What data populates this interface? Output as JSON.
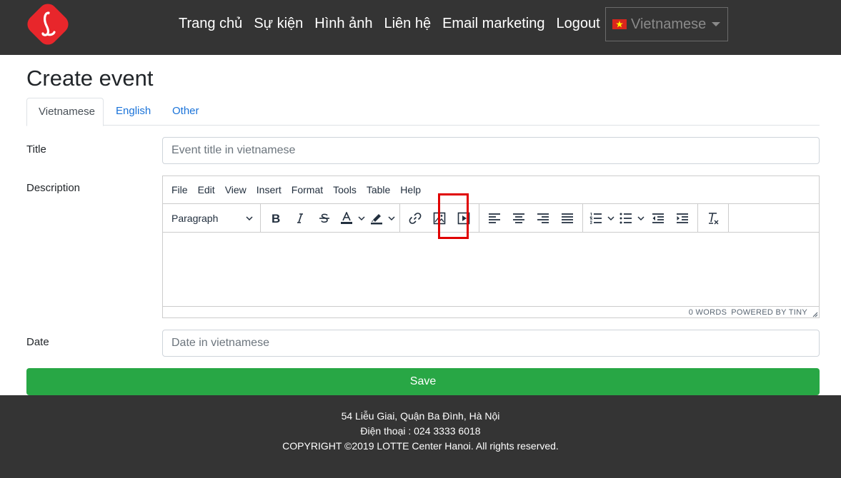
{
  "header": {
    "nav": [
      "Trang chủ",
      "Sự kiện",
      "Hình ảnh",
      "Liên hệ",
      "Email marketing",
      "Logout"
    ],
    "language": "Vietnamese",
    "brand_color": "#e8262b"
  },
  "page": {
    "title": "Create event",
    "tabs": [
      "Vietnamese",
      "English",
      "Other"
    ],
    "active_tab": "Vietnamese"
  },
  "form": {
    "title_label": "Title",
    "title_placeholder": "Event title in vietnamese",
    "description_label": "Description",
    "date_label": "Date",
    "date_placeholder": "Date in vietnamese",
    "save_label": "Save",
    "save_color": "#28a745"
  },
  "editor": {
    "menu": [
      "File",
      "Edit",
      "View",
      "Insert",
      "Format",
      "Tools",
      "Table",
      "Help"
    ],
    "block_format": "Paragraph",
    "toolbar_icons": [
      "bold-icon",
      "italic-icon",
      "strikethrough-icon",
      "text-color-icon",
      "highlight-color-icon",
      "link-icon",
      "image-icon",
      "media-icon",
      "align-left-icon",
      "align-center-icon",
      "align-right-icon",
      "justify-icon",
      "numbered-list-icon",
      "bullet-list-icon",
      "outdent-icon",
      "indent-icon",
      "clear-formatting-icon"
    ],
    "word_count": "0 WORDS",
    "powered_by": "POWERED BY TINY",
    "highlighted_button": "image-icon",
    "highlight_color": "#e00000"
  },
  "footer": {
    "address": "54 Liễu Giai, Quận Ba Đình, Hà Nội",
    "phone": "Điện thoại : 024 3333 6018",
    "copyright": "COPYRIGHT ©2019 LOTTE Center Hanoi. All rights reserved."
  }
}
